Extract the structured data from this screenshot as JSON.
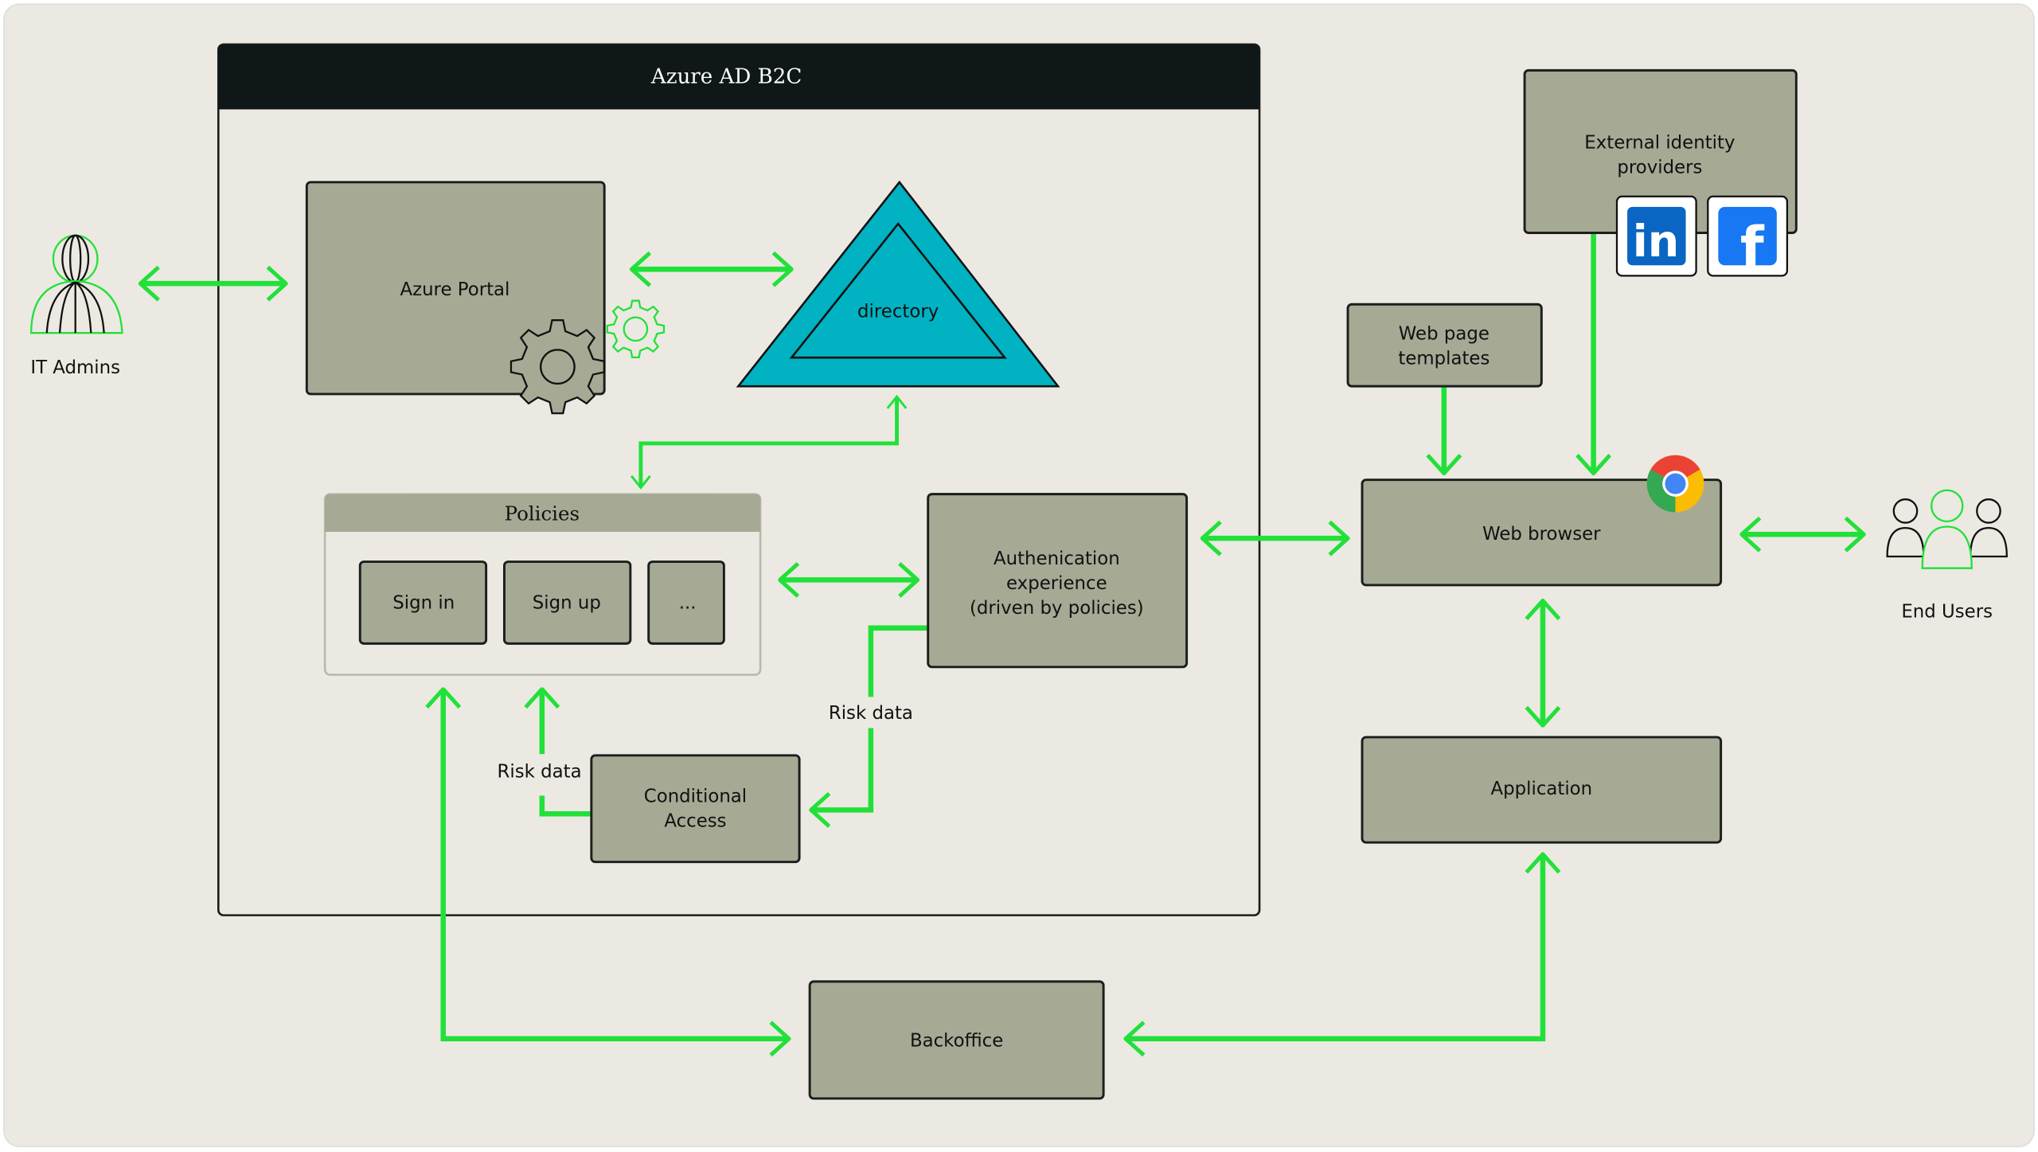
{
  "container": {
    "title": "Azure AD B2C"
  },
  "actors": {
    "it_admins": "IT Admins",
    "end_users": "End Users"
  },
  "nodes": {
    "azure_portal": "Azure Portal",
    "directory": "directory",
    "policies": {
      "title": "Policies",
      "items": [
        "Sign in",
        "Sign up",
        "..."
      ]
    },
    "auth_experience": [
      "Authenication",
      "experience",
      "(driven by policies)"
    ],
    "conditional_access": [
      "Conditional",
      "Access"
    ],
    "external_idp": [
      "External identity",
      "providers"
    ],
    "web_templates": [
      "Web page",
      "templates"
    ],
    "web_browser": "Web browser",
    "application": "Application",
    "backoffice": "Backoffice"
  },
  "edge_labels": {
    "risk_data_auth": "Risk data",
    "risk_data_ca": "Risk data"
  },
  "logos": {
    "linkedin": "in",
    "facebook": "f"
  },
  "colors": {
    "arrow": "#22e03a",
    "box": "#a6a994",
    "directory": "#00b2c2",
    "background": "#ece9e2",
    "header": "#0f1719",
    "linkedin": "#0a66c2",
    "facebook": "#1877f2"
  }
}
